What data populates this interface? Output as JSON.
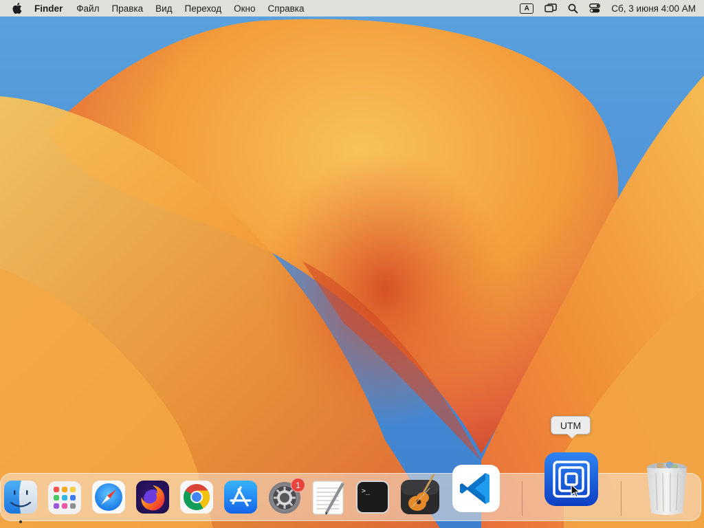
{
  "menubar": {
    "app_name": "Finder",
    "menus": [
      "Файл",
      "Правка",
      "Вид",
      "Переход",
      "Окно",
      "Справка"
    ],
    "input_source": "A",
    "clock": "Сб, 3 июня  4:00 AM",
    "icons": [
      "apple-icon",
      "input-source-icon",
      "screen-mirroring-icon",
      "spotlight-search-icon",
      "control-center-icon"
    ]
  },
  "dock": {
    "apps": [
      {
        "name": "finder",
        "icon": "finder-icon",
        "running": true
      },
      {
        "name": "launchpad",
        "icon": "launchpad-icon"
      },
      {
        "name": "safari",
        "icon": "safari-icon"
      },
      {
        "name": "firefox",
        "icon": "firefox-icon"
      },
      {
        "name": "chrome",
        "icon": "chrome-icon"
      },
      {
        "name": "app-store",
        "icon": "app-store-icon"
      },
      {
        "name": "system-settings",
        "icon": "gear-icon",
        "badge": "1"
      },
      {
        "name": "textedit",
        "icon": "textedit-icon"
      },
      {
        "name": "terminal",
        "icon": "terminal-icon"
      },
      {
        "name": "garageband",
        "icon": "guitar-icon"
      },
      {
        "name": "vscode",
        "icon": "vscode-icon"
      },
      {
        "name": "utm",
        "icon": "utm-icon"
      },
      {
        "name": "trash",
        "icon": "trash-icon"
      }
    ],
    "tooltip": "UTM",
    "terminal_prompt": ">_"
  },
  "colors": {
    "accent_blue": "#1e62d8",
    "wallpaper_orange": "#f2a13a",
    "wallpaper_blue": "#4a8fd6"
  }
}
